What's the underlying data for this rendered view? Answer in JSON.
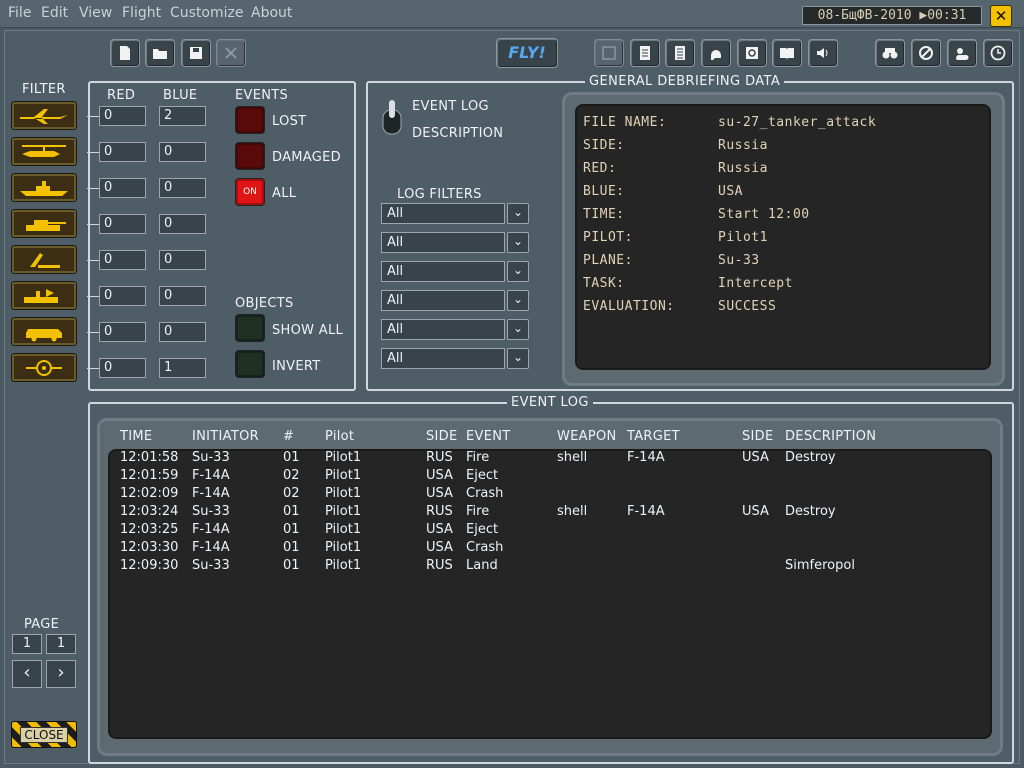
{
  "menu": [
    "File",
    "Edit",
    "View",
    "Flight",
    "Customize",
    "About"
  ],
  "clock": "08-БщФВ-2010 ▶00:31",
  "fly_label": "FLY!",
  "filter_label": "FILTER",
  "columns": {
    "red": "RED",
    "blue": "BLUE"
  },
  "filter_icons": [
    "aircraft-icon",
    "helicopter-icon",
    "ship-icon",
    "tank-icon",
    "sam-launcher-icon",
    "radar-truck-icon",
    "vehicle-icon",
    "target-icon"
  ],
  "counts": [
    {
      "red": "0",
      "blue": "2"
    },
    {
      "red": "0",
      "blue": "0"
    },
    {
      "red": "0",
      "blue": "0"
    },
    {
      "red": "0",
      "blue": "0"
    },
    {
      "red": "0",
      "blue": "0"
    },
    {
      "red": "0",
      "blue": "0"
    },
    {
      "red": "0",
      "blue": "0"
    },
    {
      "red": "0",
      "blue": "1"
    }
  ],
  "events": {
    "title": "EVENTS",
    "lost": "LOST",
    "damaged": "DAMAGED",
    "all": "ALL",
    "on_label": "ON"
  },
  "objects": {
    "title": "OBJECTS",
    "show_all": "SHOW ALL",
    "invert": "INVERT"
  },
  "general": {
    "title": "GENERAL DEBRIEFING DATA",
    "event_log": "EVENT LOG",
    "description": "DESCRIPTION",
    "log_filters": "LOG FILTERS",
    "filters": [
      "All",
      "All",
      "All",
      "All",
      "All",
      "All"
    ]
  },
  "debrief": [
    {
      "key": "FILE NAME:",
      "value": "su-27_tanker_attack"
    },
    {
      "key": "SIDE:",
      "value": "Russia"
    },
    {
      "key": "RED:",
      "value": "Russia"
    },
    {
      "key": "BLUE:",
      "value": "USA"
    },
    {
      "key": "TIME:",
      "value": "Start 12:00"
    },
    {
      "key": "PILOT:",
      "value": "Pilot1"
    },
    {
      "key": "PLANE:",
      "value": "Su-33"
    },
    {
      "key": "TASK:",
      "value": "Intercept"
    },
    {
      "key": "EVALUATION:",
      "value": "SUCCESS"
    }
  ],
  "log": {
    "title": "EVENT LOG",
    "headers": [
      "TIME",
      "INITIATOR",
      "#",
      "Pilot",
      "SIDE",
      "EVENT",
      "WEAPON",
      "TARGET",
      "SIDE",
      "DESCRIPTION"
    ],
    "rows": [
      [
        "12:01:58",
        "Su-33",
        "01",
        "Pilot1",
        "RUS",
        "Fire",
        "shell",
        "F-14A",
        "USA",
        "Destroy"
      ],
      [
        "12:01:59",
        "F-14A",
        "02",
        "Pilot1",
        "USA",
        "Eject",
        "",
        "",
        "",
        ""
      ],
      [
        "12:02:09",
        "F-14A",
        "02",
        "Pilot1",
        "USA",
        "Crash",
        "",
        "",
        "",
        ""
      ],
      [
        "12:03:24",
        "Su-33",
        "01",
        "Pilot1",
        "RUS",
        "Fire",
        "shell",
        "F-14A",
        "USA",
        "Destroy"
      ],
      [
        "12:03:25",
        "F-14A",
        "01",
        "Pilot1",
        "USA",
        "Eject",
        "",
        "",
        "",
        ""
      ],
      [
        "12:03:30",
        "F-14A",
        "01",
        "Pilot1",
        "USA",
        "Crash",
        "",
        "",
        "",
        ""
      ],
      [
        "12:09:30",
        "Su-33",
        "01",
        "Pilot1",
        "RUS",
        "Land",
        "",
        "",
        "",
        "Simferopol"
      ]
    ]
  },
  "page": {
    "label": "PAGE",
    "current": "1",
    "total": "1"
  },
  "close_label": "CLOSE",
  "colors": {
    "accent_yellow": "#f4c100",
    "screen_text": "#e1d3b6",
    "background": "#4f5d66",
    "fly_blue": "#58a8f0"
  }
}
